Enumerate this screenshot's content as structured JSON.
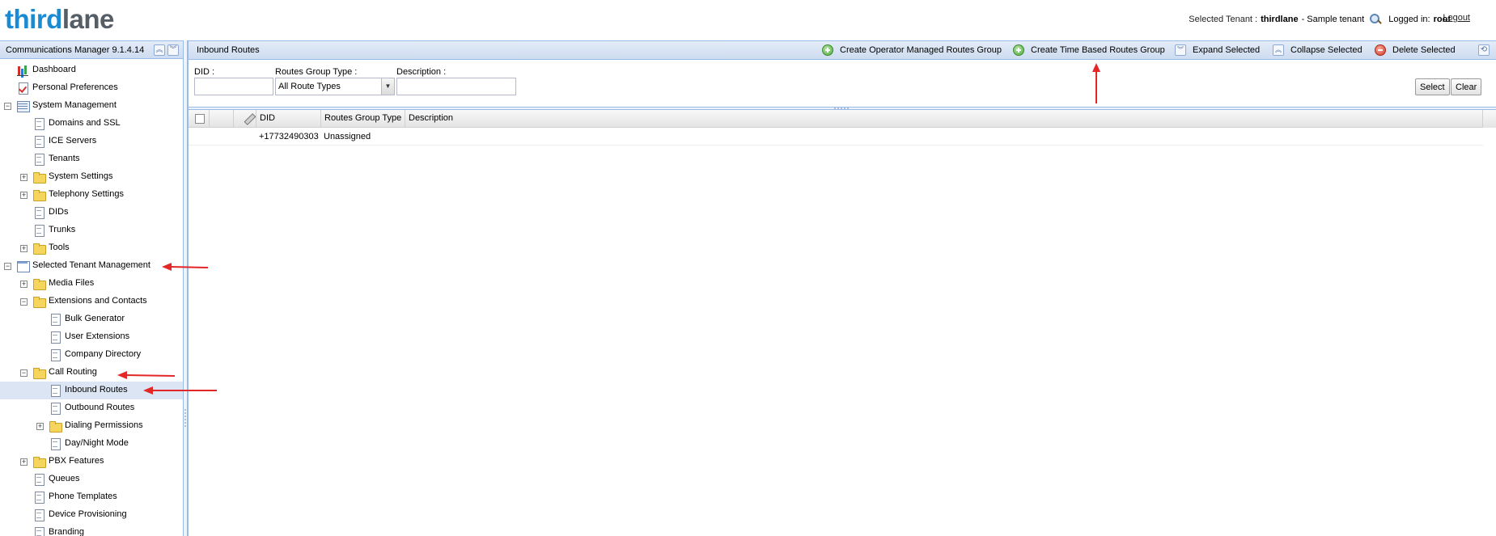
{
  "header": {
    "logo_part1": "third",
    "logo_part2": "lane",
    "selected_tenant_label": "Selected Tenant :",
    "tenant_name": "thirdlane",
    "tenant_suffix": "- Sample tenant",
    "logged_in_label": "Logged in:",
    "user": "root",
    "logout": "Logout"
  },
  "sidebar": {
    "title": "Communications Manager 9.1.4.14",
    "items": [
      {
        "label": "Dashboard",
        "icon": "chart-icon"
      },
      {
        "label": "Personal Preferences",
        "icon": "checklist-icon"
      },
      {
        "label": "System Management",
        "icon": "grid-icon",
        "expander": "minus"
      },
      {
        "label": "Domains and SSL",
        "icon": "document-icon"
      },
      {
        "label": "ICE Servers",
        "icon": "document-icon"
      },
      {
        "label": "Tenants",
        "icon": "document-icon"
      },
      {
        "label": "System Settings",
        "icon": "folder-icon",
        "expander": "plus"
      },
      {
        "label": "Telephony Settings",
        "icon": "folder-icon",
        "expander": "plus"
      },
      {
        "label": "DIDs",
        "icon": "document-icon"
      },
      {
        "label": "Trunks",
        "icon": "document-icon"
      },
      {
        "label": "Tools",
        "icon": "folder-icon",
        "expander": "plus"
      },
      {
        "label": "Selected Tenant Management",
        "icon": "window-icon",
        "expander": "minus"
      },
      {
        "label": "Media Files",
        "icon": "folder-icon",
        "expander": "plus"
      },
      {
        "label": "Extensions and Contacts",
        "icon": "folder-icon",
        "expander": "minus"
      },
      {
        "label": "Bulk Generator",
        "icon": "document-icon"
      },
      {
        "label": "User Extensions",
        "icon": "document-icon"
      },
      {
        "label": "Company Directory",
        "icon": "document-icon"
      },
      {
        "label": "Call Routing",
        "icon": "folder-icon",
        "expander": "minus"
      },
      {
        "label": "Inbound Routes",
        "icon": "document-icon",
        "selected": true
      },
      {
        "label": "Outbound Routes",
        "icon": "document-icon"
      },
      {
        "label": "Dialing Permissions",
        "icon": "folder-icon",
        "expander": "plus"
      },
      {
        "label": "Day/Night Mode",
        "icon": "document-icon"
      },
      {
        "label": "PBX Features",
        "icon": "folder-icon",
        "expander": "plus"
      },
      {
        "label": "Queues",
        "icon": "document-icon"
      },
      {
        "label": "Phone Templates",
        "icon": "document-icon"
      },
      {
        "label": "Device Provisioning",
        "icon": "document-icon"
      },
      {
        "label": "Branding",
        "icon": "document-icon"
      }
    ]
  },
  "main": {
    "title": "Inbound Routes",
    "toolbar": {
      "create_operator": "Create Operator Managed Routes Group",
      "create_time": "Create Time Based Routes Group",
      "expand": "Expand Selected",
      "collapse": "Collapse Selected",
      "delete": "Delete Selected"
    },
    "filter": {
      "did_label": "DID :",
      "did_value": "",
      "type_label": "Routes Group Type :",
      "type_value": "All Route Types",
      "desc_label": "Description :",
      "desc_value": "",
      "select_btn": "Select",
      "clear_btn": "Clear"
    },
    "grid": {
      "columns": [
        "DID",
        "Routes Group Type",
        "Description"
      ],
      "rows": [
        {
          "did": "+17732490303",
          "type": "Unassigned",
          "description": ""
        }
      ]
    }
  },
  "colors": {
    "accent": "#1a8bd3",
    "panel_border": "#99bbe8",
    "annotation_arrow": "#e32626"
  }
}
